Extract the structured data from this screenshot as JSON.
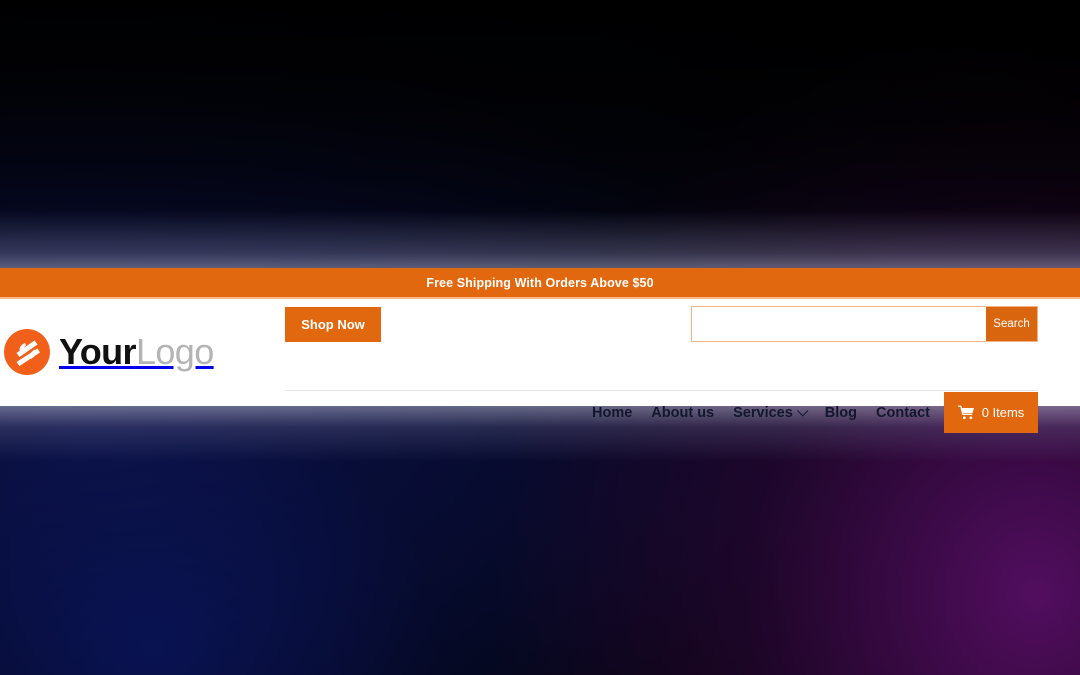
{
  "theme": {
    "accent_orange": "#e2680f",
    "accent_orange_dark": "#d9660f",
    "accent_border": "#f4b183",
    "nav_text": "#13172c",
    "logo_gray": "#b4b4b4",
    "panel_bg": "#ffffff"
  },
  "announcement": {
    "text": "Free Shipping With Orders Above $50"
  },
  "logo": {
    "mark": "swoosh-circle-icon",
    "primary": "Your",
    "secondary": "Logo"
  },
  "header": {
    "shop_now_label": "Shop Now"
  },
  "search": {
    "value": "",
    "placeholder": "",
    "button_label": "Search",
    "icon": "search-icon"
  },
  "nav": {
    "items": [
      {
        "label": "Home",
        "has_dropdown": false
      },
      {
        "label": "About us",
        "has_dropdown": false
      },
      {
        "label": "Services",
        "has_dropdown": true
      },
      {
        "label": "Blog",
        "has_dropdown": false
      },
      {
        "label": "Contact",
        "has_dropdown": false
      }
    ]
  },
  "cart": {
    "icon": "shopping-cart-icon",
    "label": "0 Items",
    "count": 0
  }
}
